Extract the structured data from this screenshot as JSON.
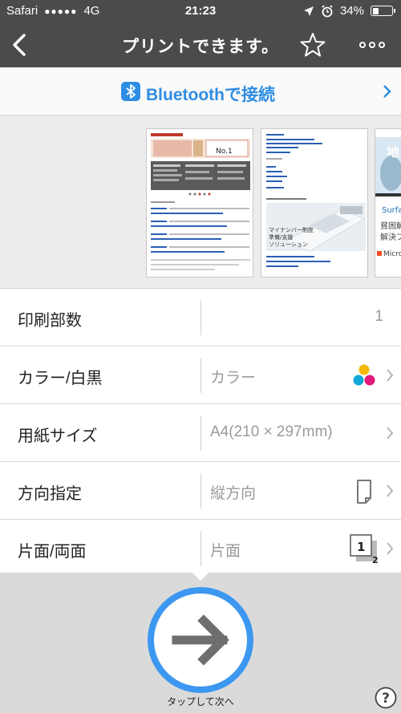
{
  "status_bar": {
    "carrier": "Safari",
    "signal": "●●●●●",
    "network": "4G",
    "time": "21:23",
    "battery": "34%",
    "battery_level": 0.34
  },
  "nav": {
    "title": "プリントできます。",
    "back_icon": "chevron-left-icon",
    "star_icon": "star-icon",
    "more_icon": "more-icon"
  },
  "bluetooth": {
    "label": "Bluetoothで接続",
    "icon": "bluetooth-icon",
    "accent": "#2f8de4"
  },
  "preview": {
    "page1": {
      "banner_title": "No.1"
    },
    "page2": {
      "caption_line1": "マイナンバー制度",
      "caption_line2": "準備/支援",
      "caption_line3": "ソリューション"
    },
    "page3": {
      "word1": "地",
      "word2": "Surfa",
      "word3": "貧困解",
      "word4": "解決プ",
      "word5": "Micro"
    }
  },
  "settings": {
    "copies": {
      "label": "印刷部数",
      "value": "1"
    },
    "color": {
      "label": "カラー/白黒",
      "value": "カラー",
      "icon": "color-dots-icon",
      "colors": [
        "#f5b90a",
        "#12a7d9",
        "#e4197a"
      ]
    },
    "paper": {
      "label": "用紙サイズ",
      "value": "A4(210 × 297mm)"
    },
    "orientation": {
      "label": "方向指定",
      "value": "縦方向",
      "icon": "portrait-page-icon"
    },
    "duplex": {
      "label": "片面/両面",
      "value": "片面",
      "icon": "single-sided-icon",
      "num1": "1",
      "num2": "2"
    }
  },
  "action": {
    "label": "タップして次へ",
    "icon": "arrow-right-icon",
    "accent": "#3c97f0"
  },
  "help": {
    "icon": "help-icon",
    "glyph": "?"
  }
}
